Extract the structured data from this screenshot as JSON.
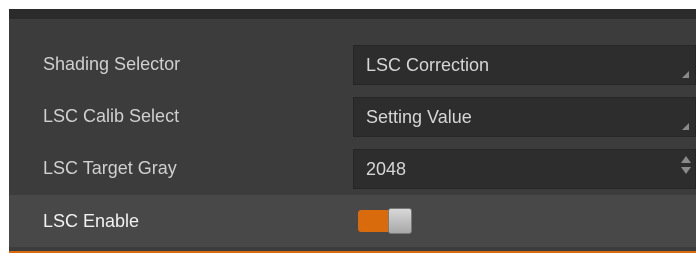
{
  "rows": [
    {
      "label": "Shading Selector",
      "control": "dropdown",
      "value": "LSC Correction"
    },
    {
      "label": "LSC Calib Select",
      "control": "dropdown",
      "value": "Setting Value"
    },
    {
      "label": "LSC Target Gray",
      "control": "spinbox",
      "value": "2048"
    },
    {
      "label": "LSC Enable",
      "control": "toggle",
      "value": "on"
    }
  ],
  "colors": {
    "panel_bg": "#3c3c3c",
    "field_bg": "#2d2d2d",
    "accent": "#d96b0c",
    "text": "#d0d0d0"
  }
}
